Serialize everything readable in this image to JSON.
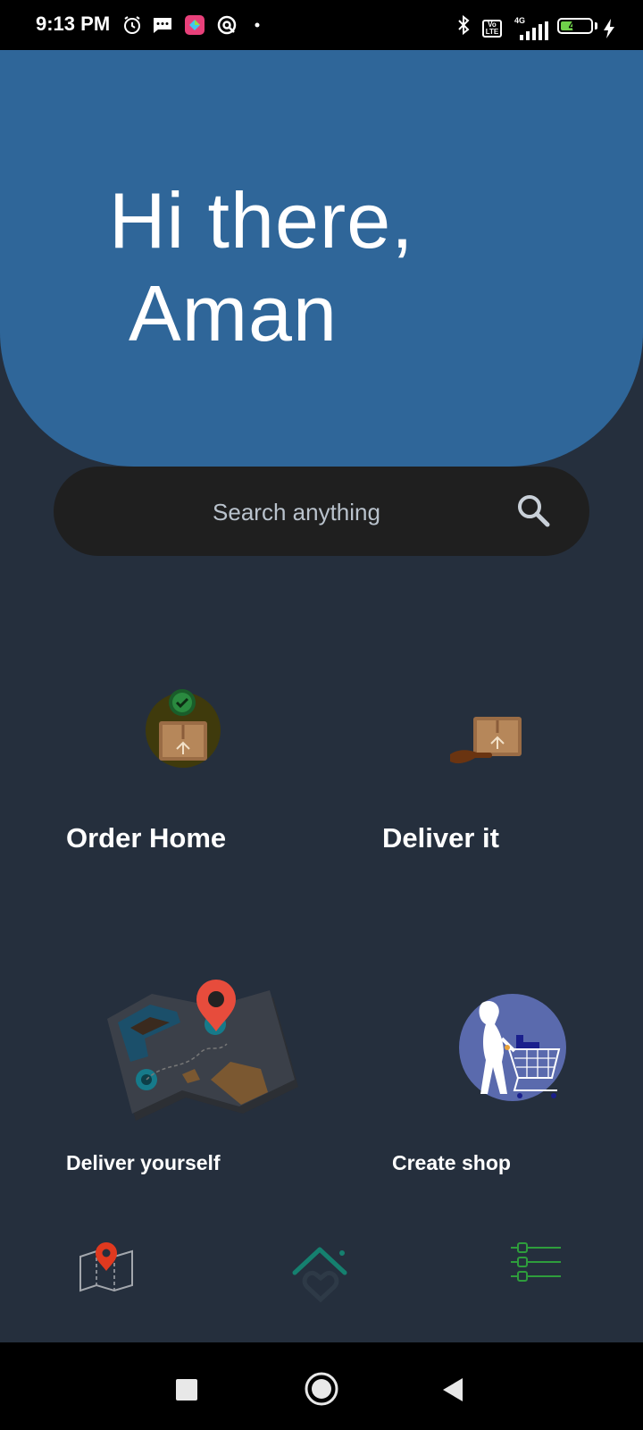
{
  "status_bar": {
    "time": "9:13 PM",
    "network": "4G",
    "volte": "Vo LTE",
    "battery": "45",
    "battery_level": 0.45,
    "icons": [
      "alarm-icon",
      "message-icon",
      "app-icon",
      "vpn-icon",
      "dot-icon",
      "bluetooth-icon",
      "volte-icon",
      "signal-icon",
      "battery-icon",
      "charging-icon"
    ]
  },
  "header": {
    "line1": "Hi there,",
    "line2": "Aman"
  },
  "search": {
    "placeholder": "Search anything",
    "icon": "search-icon"
  },
  "tiles": [
    {
      "label": "Order Home",
      "icon": "package-check-icon"
    },
    {
      "label": "Deliver it",
      "icon": "package-hand-icon"
    },
    {
      "label": "Deliver yourself",
      "icon": "map-pin-illustration"
    },
    {
      "label": "Create shop",
      "icon": "shopping-cart-illustration"
    }
  ],
  "bottom_nav": [
    {
      "name": "map",
      "icon": "map-icon"
    },
    {
      "name": "home",
      "icon": "home-heart-icon"
    },
    {
      "name": "settings",
      "icon": "list-settings-icon"
    }
  ],
  "system_nav": [
    "recents-icon",
    "home-circle-icon",
    "back-icon"
  ],
  "colors": {
    "background": "#252f3d",
    "hero": "#2f6699",
    "search_bg": "#1f1f1f",
    "accent_teal": "#15806f",
    "accent_green": "#2e9d3c",
    "pin_red": "#e74c3c"
  }
}
